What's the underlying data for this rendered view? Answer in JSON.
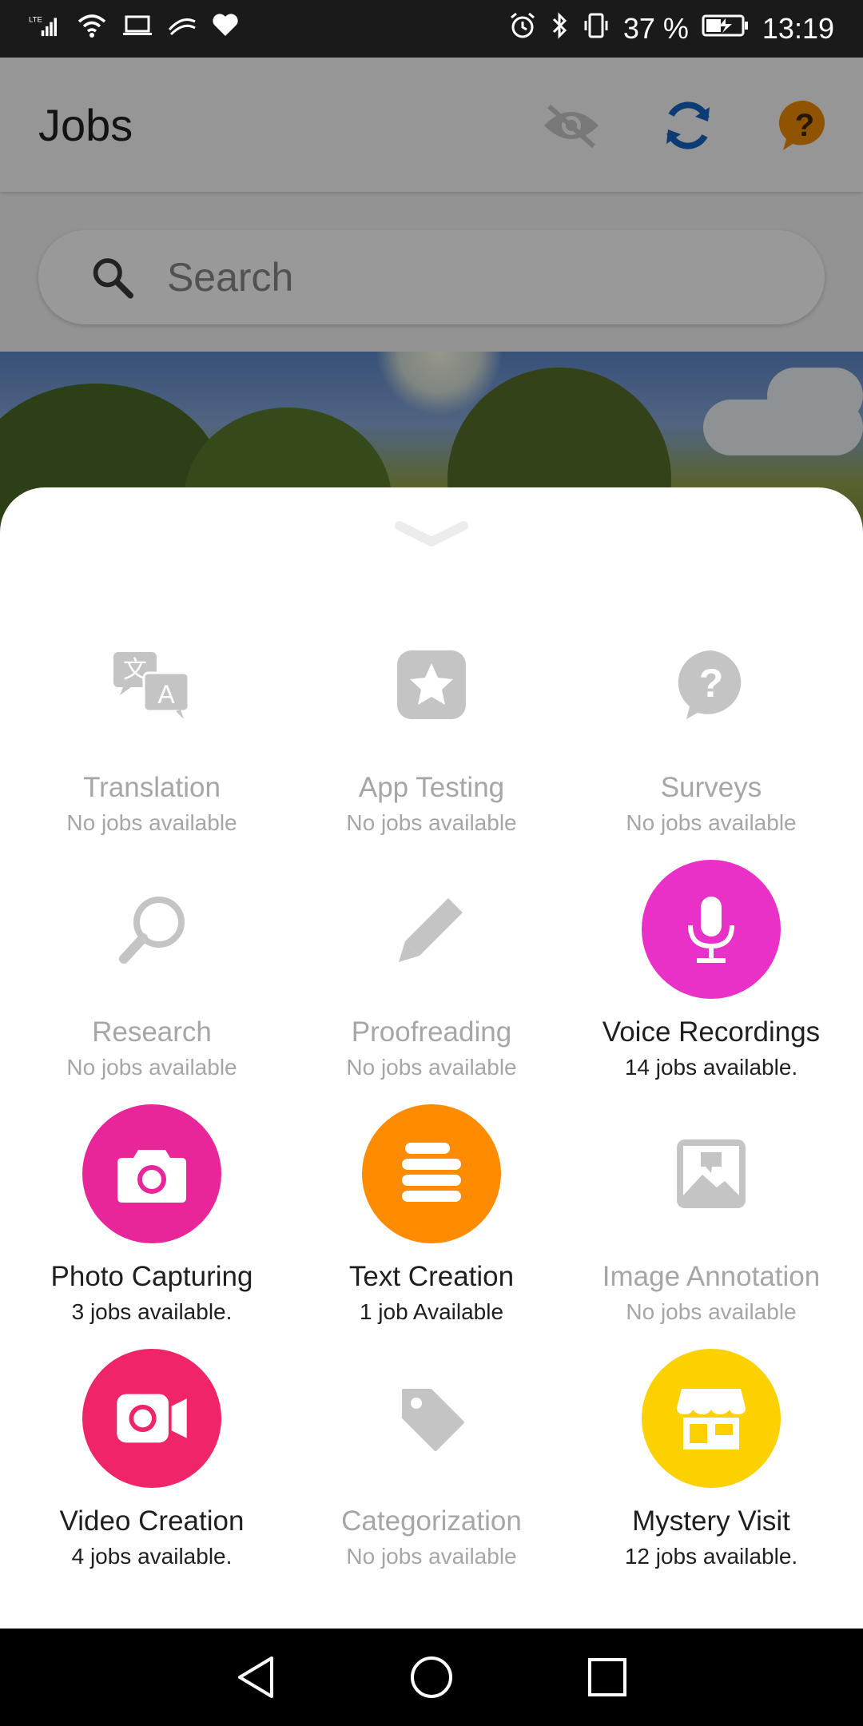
{
  "status_bar": {
    "battery": "37 %",
    "time": "13:19",
    "network": "LTE",
    "icons_left": [
      "signal-icon",
      "wifi-icon",
      "laptop-icon",
      "swiftkey-icon",
      "heart-icon"
    ],
    "icons_right": [
      "alarm-icon",
      "bluetooth-icon",
      "vibrate-icon",
      "battery-icon"
    ]
  },
  "app": {
    "title": "Jobs",
    "actions": [
      "eye-off-icon",
      "refresh-icon",
      "help-icon"
    ],
    "search": {
      "placeholder": "Search"
    }
  },
  "categories": [
    {
      "name": "Translation",
      "count": "No jobs available",
      "icon": "translate-icon",
      "active": false
    },
    {
      "name": "App Testing",
      "count": "No jobs available",
      "icon": "star-icon",
      "active": false
    },
    {
      "name": "Surveys",
      "count": "No jobs available",
      "icon": "question-icon",
      "active": false
    },
    {
      "name": "Research",
      "count": "No jobs available",
      "icon": "magnifier-icon",
      "active": false
    },
    {
      "name": "Proofreading",
      "count": "No jobs available",
      "icon": "pencil-icon",
      "active": false
    },
    {
      "name": "Voice Recordings",
      "count": "14 jobs available.",
      "icon": "microphone-icon",
      "active": true,
      "color": "#e931c8"
    },
    {
      "name": "Photo Capturing",
      "count": "3 jobs available.",
      "icon": "camera-icon",
      "active": true,
      "color": "#e9259a"
    },
    {
      "name": "Text Creation",
      "count": "1 job Available",
      "icon": "text-lines-icon",
      "active": true,
      "color": "#ff8c00"
    },
    {
      "name": "Image Annotation",
      "count": "No jobs available",
      "icon": "image-annotation-icon",
      "active": false
    },
    {
      "name": "Video Creation",
      "count": "4 jobs available.",
      "icon": "video-camera-icon",
      "active": true,
      "color": "#ef2469"
    },
    {
      "name": "Categorization",
      "count": "No jobs available",
      "icon": "tag-icon",
      "active": false
    },
    {
      "name": "Mystery Visit",
      "count": "12 jobs available.",
      "icon": "store-icon",
      "active": true,
      "color": "#fdd100"
    }
  ],
  "colors": {
    "inactive_icon": "#c4c4c4",
    "inactive_text": "#a6a6a6",
    "refresh": "#1565c0",
    "help": "#f08a00"
  },
  "nav": [
    "back-icon",
    "home-icon",
    "recents-icon"
  ]
}
